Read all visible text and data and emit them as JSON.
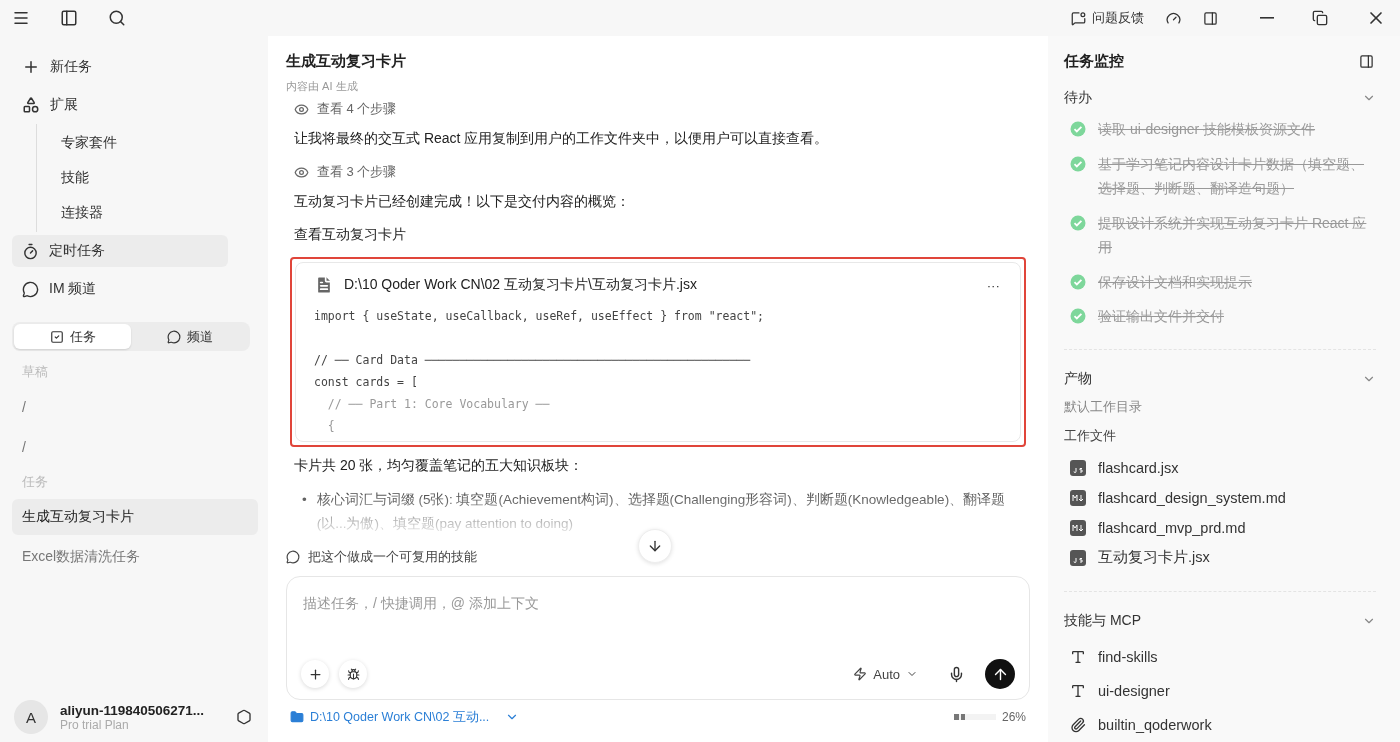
{
  "titlebar": {
    "feedback": "问题反馈"
  },
  "sidebar": {
    "nav": [
      {
        "label": "新任务",
        "kind": "item",
        "selected": false
      },
      {
        "label": "扩展",
        "kind": "item",
        "selected": false
      },
      {
        "label": "专家套件",
        "kind": "sub",
        "selected": false
      },
      {
        "label": "技能",
        "kind": "sub",
        "selected": false
      },
      {
        "label": "连接器",
        "kind": "sub",
        "selected": false
      },
      {
        "label": "定时任务",
        "kind": "item",
        "selected": true
      },
      {
        "label": "IM 频道",
        "kind": "item",
        "selected": false
      }
    ],
    "segments": [
      {
        "label": "任务",
        "selected": true
      },
      {
        "label": "频道",
        "selected": false
      }
    ],
    "groups": [
      {
        "heading": "草稿",
        "items": [
          {
            "label": "/",
            "selected": false
          },
          {
            "label": "/",
            "selected": false
          }
        ]
      },
      {
        "heading": "任务",
        "items": [
          {
            "label": "生成互动复习卡片",
            "selected": true
          },
          {
            "label": "Excel数据清洗任务",
            "selected": false
          }
        ]
      }
    ],
    "user": {
      "avatar": "A",
      "name": "aliyun-119840506271...",
      "plan": "Pro trial Plan"
    }
  },
  "main": {
    "title": "生成互动复习卡片",
    "subtitle": "内容由 AI 生成",
    "messages": [
      {
        "kind": "steps",
        "text": "查看 4 个步骤"
      },
      {
        "kind": "text",
        "text": "让我将最终的交互式 React 应用复制到用户的工作文件夹中，以便用户可以直接查看。"
      },
      {
        "kind": "steps",
        "text": "查看 3 个步骤"
      },
      {
        "kind": "text",
        "text": "互动复习卡片已经创建完成！以下是交付内容的概览："
      },
      {
        "kind": "text",
        "text": "查看互动复习卡片"
      },
      {
        "kind": "file",
        "path": "D:\\10 Qoder Work CN\\02 互动复习卡片\\互动复习卡片.jsx",
        "more": "···",
        "code": [
          [
            "import { useState, useCallback, useRef, useEffect } from \"react\";"
          ],
          [
            "// ── Card Data ───────────────────────────────────────────────",
            "const cards = [",
            "  // ── Part 1: Core Vocabulary ──",
            "  {"
          ]
        ]
      },
      {
        "kind": "text",
        "text": "卡片共 20 张，均匀覆盖笔记的五大知识板块："
      },
      {
        "kind": "bullet",
        "marker": "•",
        "text": "核心词汇与词缀 (5张): 填空题(Achievement构词)、选择题(Challenging形容词)、判断题(Knowledgeable)、翻译题(以...为傲)、填空题(pay attention to doing)"
      }
    ],
    "suggestion": "把这个做成一个可复用的技能",
    "composer": {
      "placeholder": "描述任务，/ 快捷调用，@ 添加上下文",
      "mode": "Auto"
    },
    "folder": "D:\\10 Qoder Work CN\\02 互动...",
    "usage": {
      "level": 0.26,
      "reading": "26%"
    }
  },
  "monitor": {
    "title": "任务监控",
    "todo": {
      "heading": "待办",
      "items": [
        {
          "text": "读取 ui-designer 技能模板资源文件",
          "done": true
        },
        {
          "text": "基于学习笔记内容设计卡片数据（填空题、选择题、判断题、翻译造句题）",
          "done": true
        },
        {
          "text": "提取设计系统并实现互动复习卡片 React 应用",
          "done": true
        },
        {
          "text": "保存设计文档和实现提示",
          "done": true
        },
        {
          "text": "验证输出文件并交付",
          "done": true
        }
      ]
    },
    "artifacts": {
      "heading": "产物",
      "dir": "默认工作目录",
      "subheading": "工作文件",
      "files": [
        {
          "name": "flashcard.jsx",
          "kind": "js"
        },
        {
          "name": "flashcard_design_system.md",
          "kind": "md"
        },
        {
          "name": "flashcard_mvp_prd.md",
          "kind": "md"
        },
        {
          "name": "互动复习卡片.jsx",
          "kind": "js"
        }
      ]
    },
    "skills": {
      "heading": "技能与 MCP",
      "items": [
        {
          "name": "find-skills",
          "kind": "skill"
        },
        {
          "name": "ui-designer",
          "kind": "skill"
        },
        {
          "name": "builtin_qoderwork",
          "kind": "mcp"
        }
      ]
    }
  }
}
